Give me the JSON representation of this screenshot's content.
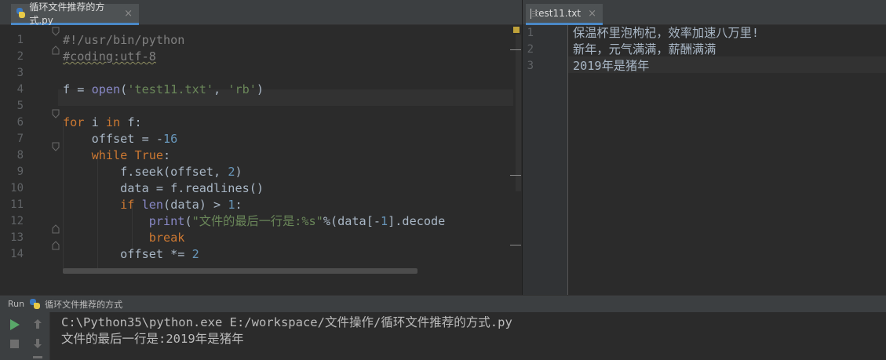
{
  "left_tab": {
    "label": "循环文件推荐的方式.py",
    "close": "×"
  },
  "right_tab": {
    "label": "test11.txt",
    "close": "×"
  },
  "editor": {
    "line_numbers": [
      "1",
      "2",
      "3",
      "4",
      "5",
      "6",
      "7",
      "8",
      "9",
      "10",
      "11",
      "12",
      "13",
      "14"
    ],
    "lines": [
      "#!/usr/bin/python",
      "#coding:utf-8",
      "",
      "f = open('test11.txt', 'rb')",
      "",
      "for i in f:",
      "    offset = -16",
      "    while True:",
      "        f.seek(offset, 2)",
      "        data = f.readlines()",
      "        if len(data) > 1:",
      "            print(\"文件的最后一行是:%s\"%(data[-1].decode",
      "            break",
      "        offset *= 2"
    ]
  },
  "text_file": {
    "line_numbers": [
      "1",
      "2",
      "3"
    ],
    "lines": [
      "保温杯里泡枸杞，效率加速八万里!",
      "新年，元气满满，薪酬满满",
      "2019年是猪年"
    ]
  },
  "run": {
    "label": "Run",
    "config_name": "循环文件推荐的方式",
    "output": [
      "C:\\Python35\\python.exe E:/workspace/文件操作/循环文件推荐的方式.py",
      "文件的最后一行是:2019年是猪年"
    ]
  },
  "colors": {
    "background": "#2b2b2b",
    "keyword": "#cc7832",
    "string": "#6a8759",
    "number": "#6897bb",
    "comment": "#808080",
    "builtin": "#8888c6",
    "text": "#a9b7c6",
    "run_icon": "#59a869"
  }
}
